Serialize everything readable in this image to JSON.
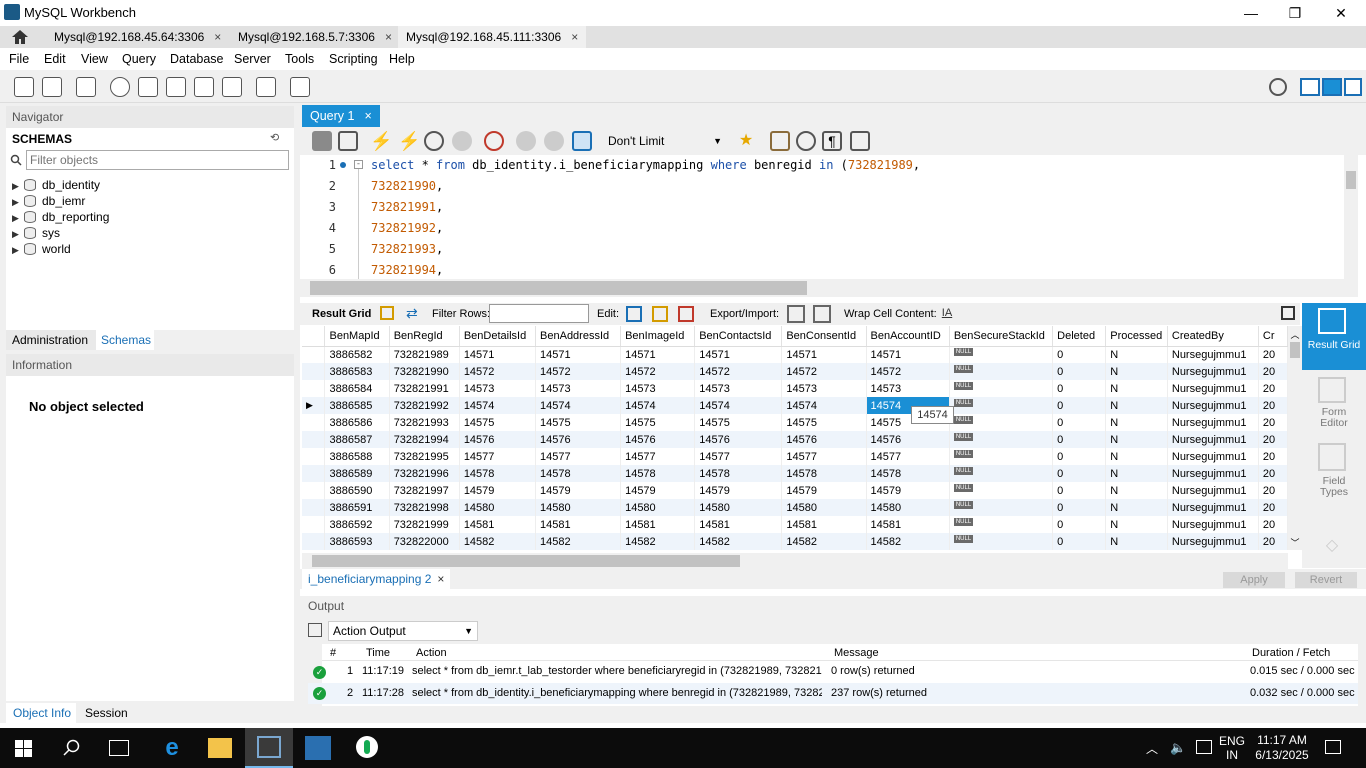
{
  "window": {
    "title": "MySQL Workbench",
    "minimize": "—",
    "maximize": "❐",
    "close": "✕"
  },
  "connection_tabs": [
    {
      "label": "Mysql@192.168.45.64:3306",
      "close": "×"
    },
    {
      "label": "Mysql@192.168.5.7:3306",
      "close": "×"
    },
    {
      "label": "Mysql@192.168.45.111:3306",
      "close": "×"
    }
  ],
  "menu": [
    "File",
    "Edit",
    "View",
    "Query",
    "Database",
    "Server",
    "Tools",
    "Scripting",
    "Help"
  ],
  "navigator": {
    "header": "Navigator",
    "schemas_title": "SCHEMAS",
    "filter_placeholder": "Filter objects",
    "schemas": [
      "db_identity",
      "db_iemr",
      "db_reporting",
      "sys",
      "world"
    ],
    "tabs": [
      "Administration",
      "Schemas"
    ],
    "information_header": "Information",
    "no_object": "No object selected",
    "bottom_tabs": [
      "Object Info",
      "Session"
    ]
  },
  "query_tab": {
    "label": "Query 1",
    "close": "×"
  },
  "query_toolbar": {
    "limit": "Don't Limit"
  },
  "editor": {
    "lines": [
      {
        "n": "1",
        "kw1": "select",
        "t1": " * ",
        "kw2": "from",
        "t2": " db_identity.i_beneficiarymapping ",
        "kw3": "where",
        "t3": " benregid ",
        "kw4": "in",
        "t4": " (",
        "num": "732821989",
        "t5": ","
      },
      {
        "n": "2",
        "num": "732821990",
        "t5": ","
      },
      {
        "n": "3",
        "num": "732821991",
        "t5": ","
      },
      {
        "n": "4",
        "num": "732821992",
        "t5": ","
      },
      {
        "n": "5",
        "num": "732821993",
        "t5": ","
      },
      {
        "n": "6",
        "num": "732821994",
        "t5": ","
      }
    ]
  },
  "result_toolbar": {
    "result_grid": "Result Grid",
    "filter_rows": "Filter Rows:",
    "edit": "Edit:",
    "export_import": "Export/Import:",
    "wrap": "Wrap Cell Content:"
  },
  "grid": {
    "columns": [
      "BenMapId",
      "BenRegId",
      "BenDetailsId",
      "BenAddressId",
      "BenImageId",
      "BenContactsId",
      "BenConsentId",
      "BenAccountID",
      "BenSecureStackId",
      "Deleted",
      "Processed",
      "CreatedBy",
      "Cr"
    ],
    "null_label": "NULL",
    "rows": [
      [
        "3886582",
        "732821989",
        "14571",
        "14571",
        "14571",
        "14571",
        "14571",
        "14571",
        "0",
        "N",
        "Nursegujmmu1",
        "20"
      ],
      [
        "3886583",
        "732821990",
        "14572",
        "14572",
        "14572",
        "14572",
        "14572",
        "14572",
        "0",
        "N",
        "Nursegujmmu1",
        "20"
      ],
      [
        "3886584",
        "732821991",
        "14573",
        "14573",
        "14573",
        "14573",
        "14573",
        "14573",
        "0",
        "N",
        "Nursegujmmu1",
        "20"
      ],
      [
        "3886585",
        "732821992",
        "14574",
        "14574",
        "14574",
        "14574",
        "14574",
        "14574",
        "0",
        "N",
        "Nursegujmmu1",
        "20"
      ],
      [
        "3886586",
        "732821993",
        "14575",
        "14575",
        "14575",
        "14575",
        "14575",
        "14575",
        "0",
        "N",
        "Nursegujmmu1",
        "20"
      ],
      [
        "3886587",
        "732821994",
        "14576",
        "14576",
        "14576",
        "14576",
        "14576",
        "14576",
        "0",
        "N",
        "Nursegujmmu1",
        "20"
      ],
      [
        "3886588",
        "732821995",
        "14577",
        "14577",
        "14577",
        "14577",
        "14577",
        "14577",
        "0",
        "N",
        "Nursegujmmu1",
        "20"
      ],
      [
        "3886589",
        "732821996",
        "14578",
        "14578",
        "14578",
        "14578",
        "14578",
        "14578",
        "0",
        "N",
        "Nursegujmmu1",
        "20"
      ],
      [
        "3886590",
        "732821997",
        "14579",
        "14579",
        "14579",
        "14579",
        "14579",
        "14579",
        "0",
        "N",
        "Nursegujmmu1",
        "20"
      ],
      [
        "3886591",
        "732821998",
        "14580",
        "14580",
        "14580",
        "14580",
        "14580",
        "14580",
        "0",
        "N",
        "Nursegujmmu1",
        "20"
      ],
      [
        "3886592",
        "732821999",
        "14581",
        "14581",
        "14581",
        "14581",
        "14581",
        "14581",
        "0",
        "N",
        "Nursegujmmu1",
        "20"
      ],
      [
        "3886593",
        "732822000",
        "14582",
        "14582",
        "14582",
        "14582",
        "14582",
        "14582",
        "0",
        "N",
        "Nursegujmmu1",
        "20"
      ]
    ],
    "selected_row": 3,
    "tooltip": "14574"
  },
  "side_panel": [
    "Result Grid",
    "Form Editor",
    "Field Types"
  ],
  "result_tab": {
    "label": "i_beneficiarymapping 2",
    "close": "×"
  },
  "buttons": {
    "apply": "Apply",
    "revert": "Revert"
  },
  "output": {
    "header": "Output",
    "mode": "Action Output",
    "columns": [
      "#",
      "Time",
      "Action",
      "Message",
      "Duration / Fetch"
    ],
    "rows": [
      {
        "n": "1",
        "time": "11:17:19",
        "action": "select * from db_iemr.t_lab_testorder where beneficiaryregid in (732821989, 7328219...",
        "message": "0 row(s) returned",
        "duration": "0.015 sec / 0.000 sec"
      },
      {
        "n": "2",
        "time": "11:17:28",
        "action": "select * from db_identity.i_beneficiarymapping where benregid in (732821989, 73282...",
        "message": "237 row(s) returned",
        "duration": "0.032 sec / 0.000 sec"
      }
    ]
  },
  "taskbar": {
    "lang1": "ENG",
    "lang2": "IN",
    "time": "11:17 AM",
    "date": "6/13/2025"
  }
}
